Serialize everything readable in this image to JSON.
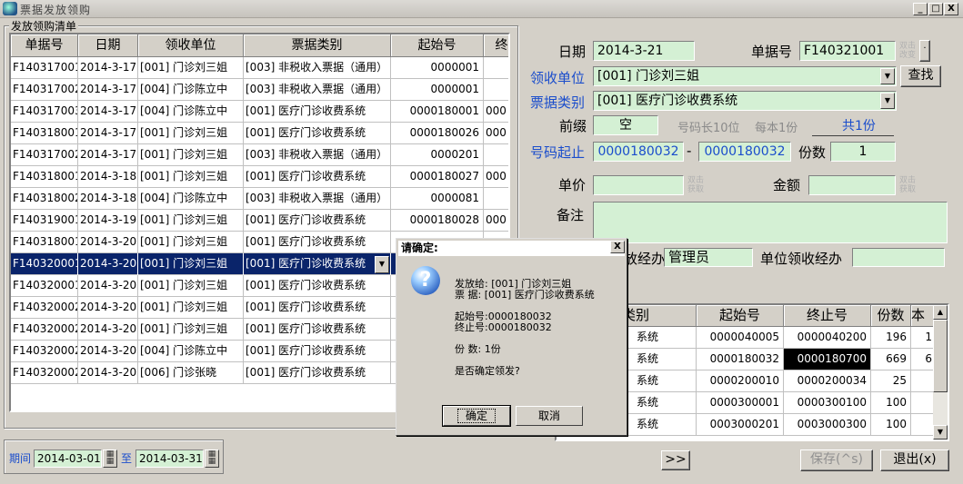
{
  "window": {
    "title": "票据发放领购",
    "min": "_",
    "max": "□",
    "close": "X"
  },
  "list_group": {
    "label": "发放领购清单"
  },
  "grid": {
    "headers": [
      "单据号",
      "日期",
      "领收单位",
      "票据类别",
      "起始号",
      "终"
    ],
    "rows": [
      [
        "F140317001",
        "2014-3-17",
        "[001] 门诊刘三姐",
        "[003] 非税收入票据（通用）",
        "0000001",
        ""
      ],
      [
        "F140317002",
        "2014-3-17",
        "[004] 门诊陈立中",
        "[003] 非税收入票据（通用）",
        "0000001",
        ""
      ],
      [
        "F140317003",
        "2014-3-17",
        "[004] 门诊陈立中",
        "[001] 医疗门诊收费系统",
        "0000180001",
        "000"
      ],
      [
        "F140318001",
        "2014-3-17",
        "[001] 门诊刘三姐",
        "[001] 医疗门诊收费系统",
        "0000180026",
        "000"
      ],
      [
        "F140317002",
        "2014-3-17",
        "[001] 门诊刘三姐",
        "[003] 非税收入票据（通用）",
        "0000201",
        ""
      ],
      [
        "F140318001",
        "2014-3-18",
        "[001] 门诊刘三姐",
        "[001] 医疗门诊收费系统",
        "0000180027",
        "000"
      ],
      [
        "F140318002",
        "2014-3-18",
        "[004] 门诊陈立中",
        "[003] 非税收入票据（通用）",
        "0000081",
        ""
      ],
      [
        "F140319001",
        "2014-3-19",
        "[001] 门诊刘三姐",
        "[001] 医疗门诊收费系统",
        "0000180028",
        "000"
      ],
      [
        "F140318001",
        "2014-3-20",
        "[001] 门诊刘三姐",
        "[001] 医疗门诊收费系统",
        "",
        ""
      ],
      [
        "F140320001",
        "2014-3-20",
        "[001] 门诊刘三姐",
        "[001] 医疗门诊收费系统",
        "",
        ""
      ],
      [
        "F140320001",
        "2014-3-20",
        "[001] 门诊刘三姐",
        "[001] 医疗门诊收费系统",
        "",
        ""
      ],
      [
        "F140320002",
        "2014-3-20",
        "[001] 门诊刘三姐",
        "[001] 医疗门诊收费系统",
        "",
        ""
      ],
      [
        "F140320002",
        "2014-3-20",
        "[001] 门诊刘三姐",
        "[001] 医疗门诊收费系统",
        "",
        ""
      ],
      [
        "F140320002",
        "2014-3-20",
        "[004] 门诊陈立中",
        "[001] 医疗门诊收费系统",
        "",
        ""
      ],
      [
        "F140320002",
        "2014-3-20",
        "[006] 门诊张晓",
        "[001] 医疗门诊收费系统",
        "",
        ""
      ]
    ],
    "selected_row": 9
  },
  "filter": {
    "period_label": "期间",
    "from": "2014-03-01",
    "to_label": "至",
    "to": "2014-03-31",
    "cal_icon": "calendar-icon"
  },
  "form": {
    "date_label": "日期",
    "date": "2014-3-21",
    "doc_label": "单据号",
    "doc_no": "F140321001",
    "dbl_hint": "双击改变",
    "unit_label": "领收单位",
    "unit": "[001] 门诊刘三姐",
    "find_btn": "查找",
    "type_label": "票据类别",
    "type": "[001] 医疗门诊收费系统",
    "prefix_label": "前缀",
    "prefix": "空",
    "code_len": "号码长10位",
    "per_book": "每本1份",
    "total": "共1份",
    "range_label": "号码起止",
    "range_from": "0000180032",
    "range_sep": "-",
    "range_to": "0000180032",
    "count_label": "份数",
    "count": "1",
    "price_label": "单价",
    "price_hint": "双击获取",
    "amount_label": "金额",
    "amount_hint": "双击获取",
    "remark_label": "备注",
    "handler_label": "发放经办",
    "handler_label_visible": "放经办",
    "handler": "管理员",
    "recv_handler_label": "单位领收经办"
  },
  "right_grid": {
    "headers": [
      "类别",
      "起始号",
      "终止号",
      "份数",
      "本送"
    ],
    "rows": [
      [
        "系统",
        "0000040005",
        "0000040200",
        "196",
        "1"
      ],
      [
        "系统",
        "0000180032",
        "0000180700",
        "669",
        "6"
      ],
      [
        "系统",
        "0000200010",
        "0000200034",
        "25",
        ""
      ],
      [
        "系统",
        "0000300001",
        "0000300100",
        "100",
        ""
      ],
      [
        "系统",
        "0003000201",
        "0003000300",
        "100",
        ""
      ]
    ],
    "selected_cell": "0000180700"
  },
  "buttons": {
    "next": ">>",
    "save": "保存(^s)",
    "exit": "退出(x)"
  },
  "dialog": {
    "title": "请确定:",
    "close": "X",
    "icon": "question-icon",
    "line1_label": "发放给:",
    "line1_value": "[001] 门诊刘三姐",
    "line2_label": "票  据:",
    "line2_value": "[001] 医疗门诊收费系统",
    "line3_label": "起始号:",
    "line3_value": "0000180032",
    "line4_label": "终止号:",
    "line4_value": "0000180032",
    "line5_label": "份  数:",
    "line5_value": "1份",
    "question": "是否确定领发?",
    "ok": "确定",
    "cancel": "取消"
  }
}
